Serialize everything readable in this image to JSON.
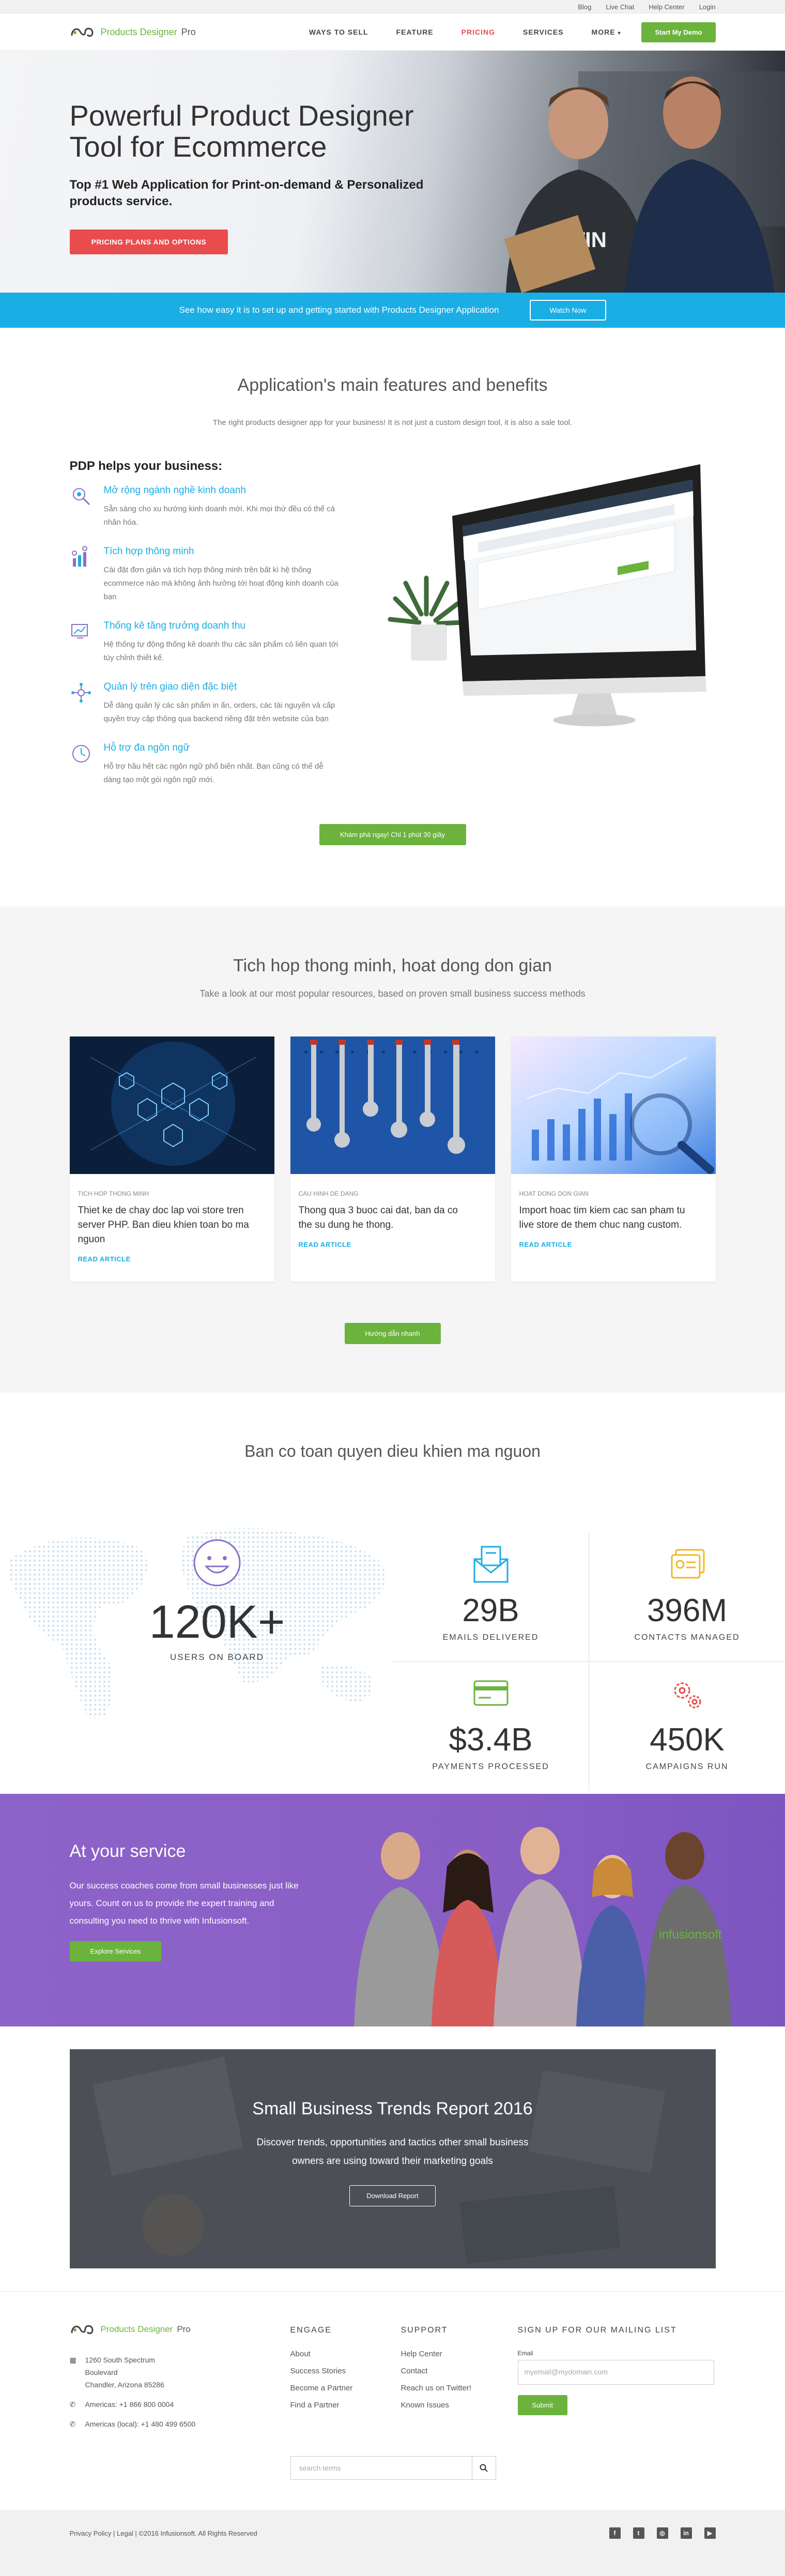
{
  "util_links": [
    "Blog",
    "Live Chat",
    "Help Center",
    "Login"
  ],
  "nav": {
    "brand": "Products Designer",
    "brand_suffix": "Pro",
    "items": [
      "WAYS TO SELL",
      "FEATURE",
      "PRICING",
      "SERVICES",
      "MORE"
    ],
    "active_item": "PRICING",
    "demo_label": "Start My Demo"
  },
  "hero": {
    "title": "Powerful Product Designer Tool for Ecommerce",
    "subtitle": "Top #1 Web Application for Print-on-demand & Personalized products service.",
    "cta": "PRICING PLANS AND OPTIONS",
    "shirt_text": "TITIN"
  },
  "band": {
    "text": "See how easy it is to set up and getting started with Products Designer Application",
    "button": "Watch Now"
  },
  "features": {
    "title": "Application's main features and benefits",
    "lead": "The right products designer app for your business! It is not just a custom design tool, it is also a sale tool.",
    "heading": "PDP helps your business:",
    "items": [
      {
        "title": "Mở rộng ngành nghề kinh doanh",
        "text": "Sẵn sàng cho xu hướng kinh doanh mới. Khi mọi thứ đều có thể cá nhân hóa."
      },
      {
        "title": "Tích hợp thông minh",
        "text": "Cài đặt đơn giản và tích hợp thông minh trên bất kì hệ thống ecommerce nào mà không ảnh hưởng tới hoạt động kinh doanh của bạn"
      },
      {
        "title": "Thống kê tăng trưởng doanh thu",
        "text": "Hệ thống tự động thống kê doanh thu các sản phẩm có liên quan tới tùy chỉnh thiết kế."
      },
      {
        "title": "Quản lý trên giao diện đặc biệt",
        "text": "Dễ dàng quản lý các sản phẩm in ấn, orders, các tài nguyên và cấp quyền truy cập thông qua backend riêng đặt trên website của bạn"
      },
      {
        "title": "Hỗ trợ đa ngôn ngữ",
        "text": "Hỗ trợ hầu hết các ngôn ngữ phổ biến nhất. Bạn cũng có thể dễ dàng tạo một gói ngôn ngữ mới."
      }
    ],
    "cta": "Khám phá ngay! Chỉ 1 phút 30 giây"
  },
  "articles": {
    "title": "Tich hop thong minh, hoat dong don gian",
    "lead": "Take a look at our most popular resources, based on proven small business success methods",
    "cards": [
      {
        "category": "TICH HOP THONG MINH",
        "title": "Thiet ke de chay doc lap voi store tren server PHP. Ban dieu khien toan bo ma nguon",
        "link": "READ ARTICLE"
      },
      {
        "category": "CAU HINH DE DANG",
        "title": "Thong qua 3 buoc cai dat, ban da co the su dung he thong.",
        "link": "READ ARTICLE"
      },
      {
        "category": "HOAT DONG DON GIAN",
        "title": "Import hoac tim kiem cac san pham tu live store de them chuc nang custom.",
        "link": "READ ARTICLE"
      }
    ],
    "cta": "Hướng dẫn nhanh"
  },
  "stats": {
    "title": "Ban co toan quyen dieu khien ma nguon",
    "users_value": "120K+",
    "users_label": "USERS ON BOARD",
    "items": [
      {
        "value": "29B",
        "label": "EMAILS DELIVERED",
        "icon": "email-icon",
        "color": "#1aaee5"
      },
      {
        "value": "396M",
        "label": "CONTACTS MANAGED",
        "icon": "contacts-icon",
        "color": "#f2b824"
      },
      {
        "value": "$3.4B",
        "label": "PAYMENTS PROCESSED",
        "icon": "credit-card-icon",
        "color": "#6cb33e"
      },
      {
        "value": "450K",
        "label": "CAMPAIGNS RUN",
        "icon": "gears-icon",
        "color": "#e94c4c"
      }
    ]
  },
  "service": {
    "title": "At your service",
    "text": "Our success coaches come from small businesses just like yours. Count on us to provide the expert training and consulting you need to thrive with Infusionsoft.",
    "button": "Explore Services",
    "shirt_text": "infusionsoft"
  },
  "trends": {
    "title": "Small Business Trends Report 2016",
    "text": "Discover trends, opportunities and tactics other small business owners are using toward their marketing goals",
    "button": "Download Report"
  },
  "footer": {
    "brand": "Products Designer",
    "brand_suffix": "Pro",
    "address": [
      "1260 South Spectrum",
      "Boulevard",
      "Chandler, Arizona 85286"
    ],
    "phone1": "Americas: +1 866 800 0004",
    "phone2": "Americas (local): +1 480 499 6500",
    "engage_title": "ENGAGE",
    "engage": [
      "About",
      "Success Stories",
      "Become a Partner",
      "Find a Partner"
    ],
    "support_title": "SUPPORT",
    "support": [
      "Help Center",
      "Contact",
      "Reach us on Twitter!",
      "Known Issues"
    ],
    "mail_title": "SIGN UP FOR OUR MAILING LIST",
    "email_label": "Email",
    "email_placeholder": "myemail@mydomain.com",
    "submit": "Submit",
    "search_placeholder": "search terms",
    "copyright": "Privacy Policy | Legal | ©2016 Infusionsoft. All Rights Reserved",
    "socials": [
      "facebook-icon",
      "twitter-icon",
      "instagram-icon",
      "linkedin-icon",
      "youtube-icon"
    ]
  }
}
